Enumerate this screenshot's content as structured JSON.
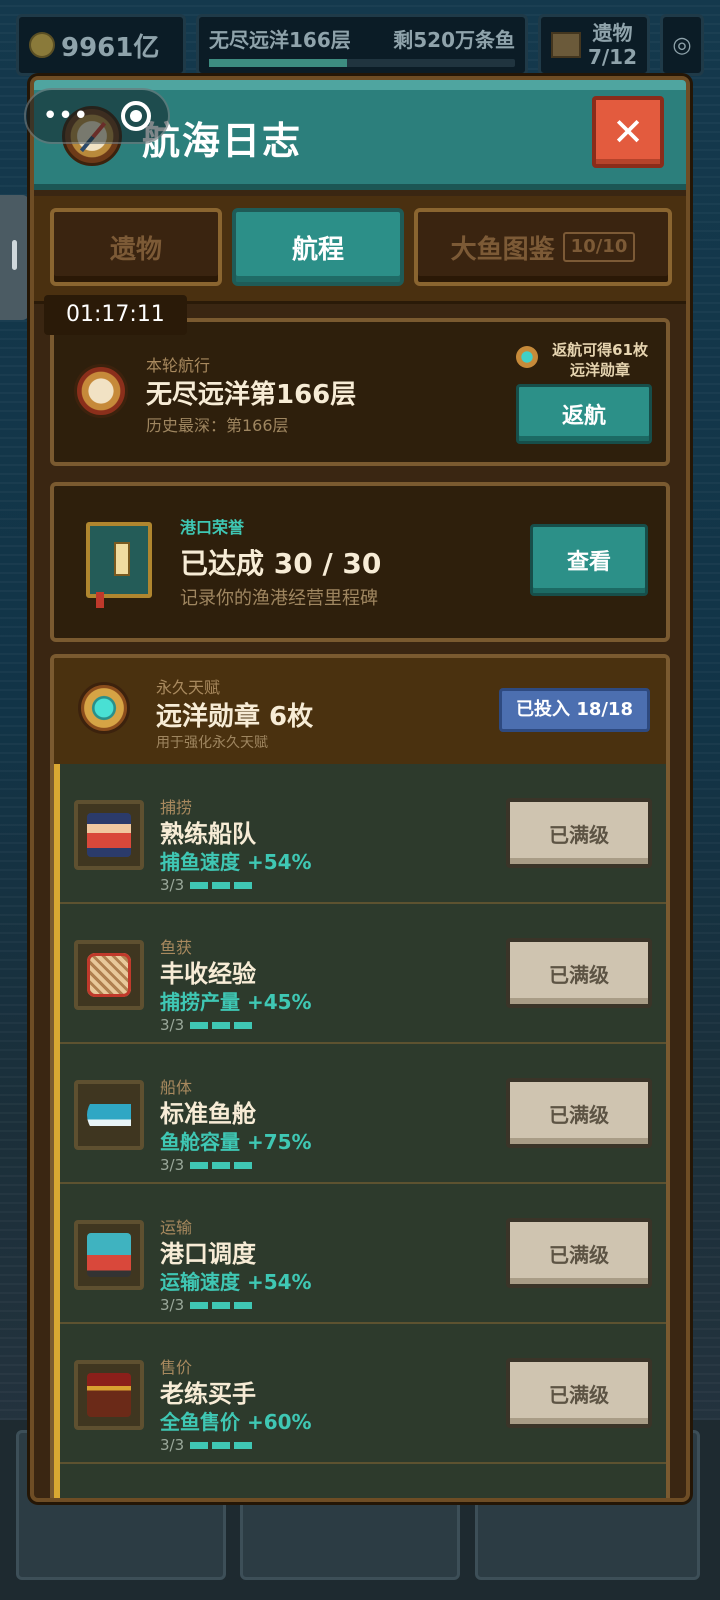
{
  "hud": {
    "coins": "9961亿",
    "depth_label": "无尽远洋166层",
    "fish_left": "剩520万条鱼",
    "relic_label": "遗物",
    "relic_count": "7/12"
  },
  "dialog": {
    "title": "航海日志",
    "close_symbol": "✕",
    "tabs": [
      {
        "label": "遗物",
        "active": false
      },
      {
        "label": "航程",
        "active": true
      },
      {
        "label": "大鱼图鉴",
        "badge": "10/10",
        "active": false
      }
    ],
    "timer": "01:17:11"
  },
  "voyage": {
    "label": "本轮航行",
    "current": "无尽远洋第166层",
    "best": "历史最深：第166层",
    "reward_line1": "返航可得61枚",
    "reward_line2": "远洋勋章",
    "return_button": "返航"
  },
  "honor": {
    "label": "港口荣誉",
    "progress": "已达成 30 / 30",
    "desc": "记录你的渔港经营里程碑",
    "view_button": "查看"
  },
  "talents": {
    "label": "永久天赋",
    "medals": "远洋勋章 6枚",
    "desc": "用于强化永久天赋",
    "invested": "已投入 18/18",
    "items": [
      {
        "category": "捕捞",
        "name": "熟练船队",
        "effect": "捕鱼速度 +54%",
        "level": "3/3",
        "button": "已满级"
      },
      {
        "category": "鱼获",
        "name": "丰收经验",
        "effect": "捕捞产量 +45%",
        "level": "3/3",
        "button": "已满级"
      },
      {
        "category": "船体",
        "name": "标准鱼舱",
        "effect": "鱼舱容量 +75%",
        "level": "3/3",
        "button": "已满级"
      },
      {
        "category": "运输",
        "name": "港口调度",
        "effect": "运输速度 +54%",
        "level": "3/3",
        "button": "已满级"
      },
      {
        "category": "售价",
        "name": "老练买手",
        "effect": "全鱼售价 +60%",
        "level": "3/3",
        "button": "已满级"
      }
    ]
  },
  "colors": {
    "header_teal": "#2c7f7c",
    "close_red": "#e35b3e",
    "panel_brown": "#3a2612",
    "effect_teal": "#3fc7b4",
    "invested_blue": "#4c6fb0"
  }
}
